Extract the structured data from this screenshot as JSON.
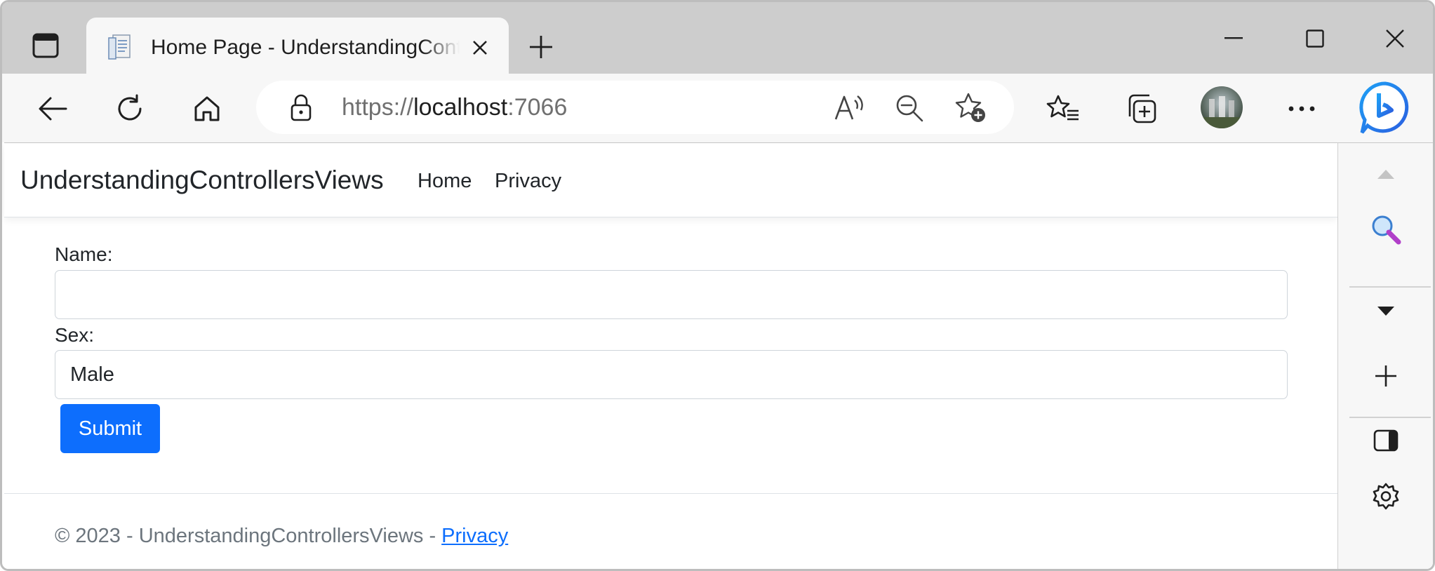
{
  "browser": {
    "tab": {
      "title": "Home Page - UnderstandingControllersViews",
      "favicon": "document-page-icon"
    },
    "address": {
      "scheme": "https://",
      "host": "localhost",
      "port": ":7066"
    },
    "toolbar_icons": [
      "back-icon",
      "refresh-icon",
      "home-icon",
      "lock-icon",
      "read-aloud-icon",
      "zoom-out-icon",
      "add-favorite-icon",
      "favorites-icon",
      "collections-icon",
      "profile-avatar",
      "more-icon",
      "copilot-icon"
    ],
    "window_controls": [
      "minimize-icon",
      "maximize-icon",
      "close-icon"
    ],
    "sidebar_icons": [
      "scroll-up-icon",
      "search-icon",
      "expand-down-icon",
      "add-icon",
      "split-screen-icon",
      "settings-icon"
    ]
  },
  "site": {
    "brand": "UnderstandingControllersViews",
    "nav": {
      "home": "Home",
      "privacy": "Privacy"
    }
  },
  "form": {
    "name_label": "Name:",
    "name_value": "",
    "sex_label": "Sex:",
    "sex_value": "Male",
    "submit_label": "Submit"
  },
  "footer": {
    "text": "© 2023 - UnderstandingControllersViews - ",
    "link": "Privacy"
  },
  "colors": {
    "primary": "#0d6efd",
    "tabstrip": "#cdcdcd",
    "toolbar": "#f7f7f7",
    "muted_text": "#6c757d"
  }
}
